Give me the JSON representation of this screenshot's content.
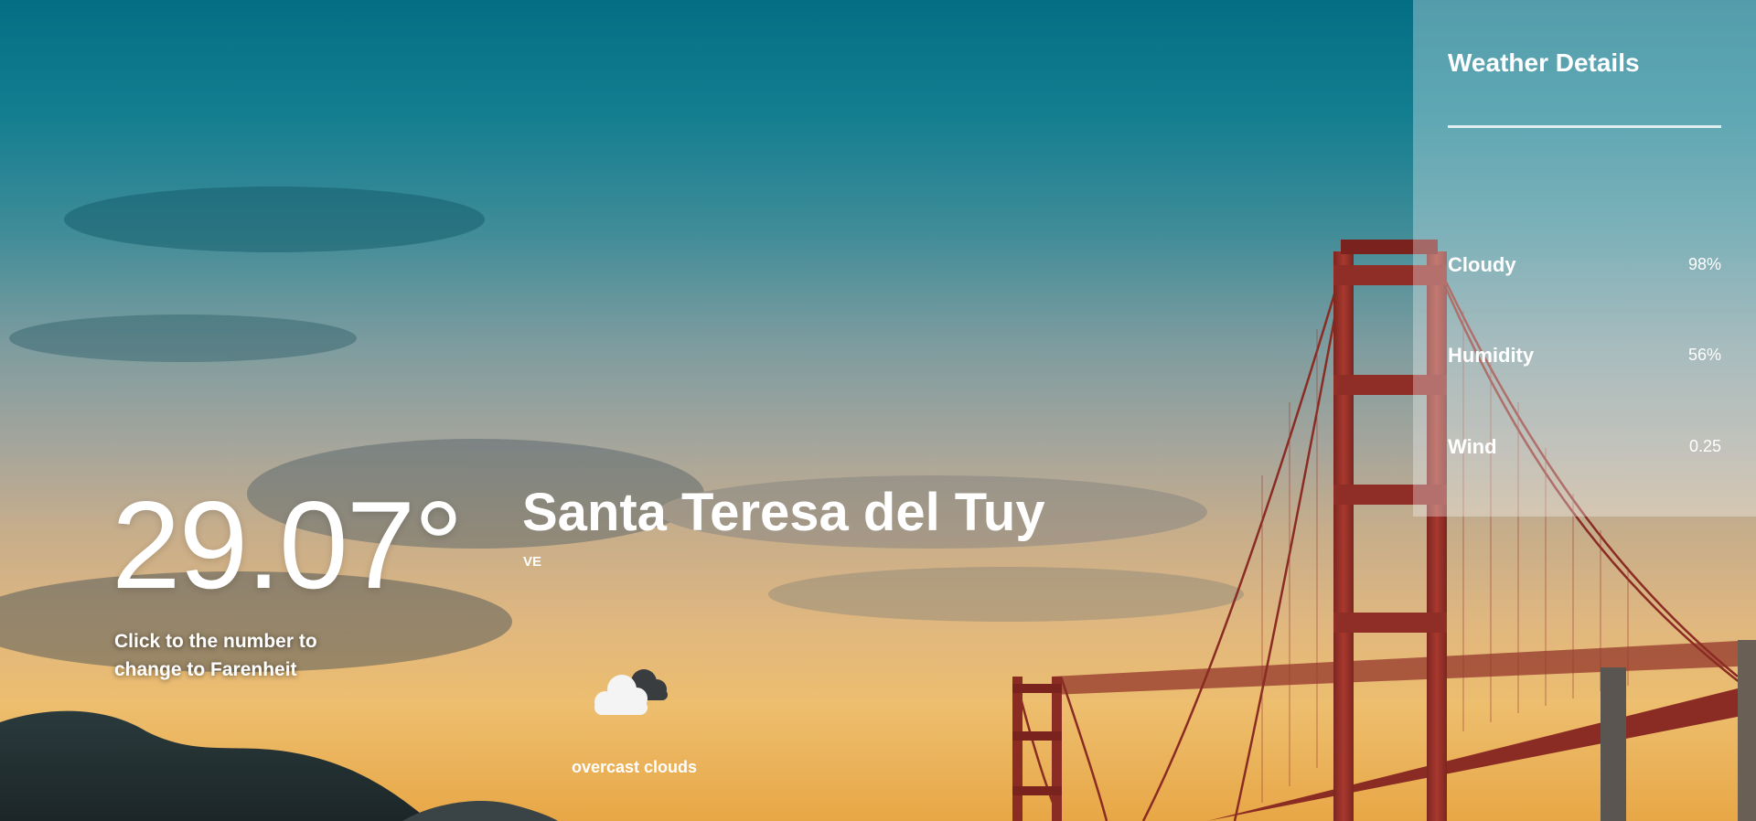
{
  "weather": {
    "temperature": "29.07°",
    "unit_hint": "Click to the number to change to Farenheit",
    "city": "Santa Teresa del Tuy",
    "country": "VE",
    "condition": "overcast clouds",
    "condition_icon": "cloud-icon"
  },
  "details": {
    "title": "Weather Details",
    "items": [
      {
        "label": "Cloudy",
        "value": "98%"
      },
      {
        "label": "Humidity",
        "value": "56%"
      },
      {
        "label": "Wind",
        "value": "0.25"
      }
    ]
  },
  "colors": {
    "sky_top": "#046e84",
    "sky_bottom": "#e8a746",
    "bridge": "#9b2f2a",
    "text": "#ffffff"
  }
}
